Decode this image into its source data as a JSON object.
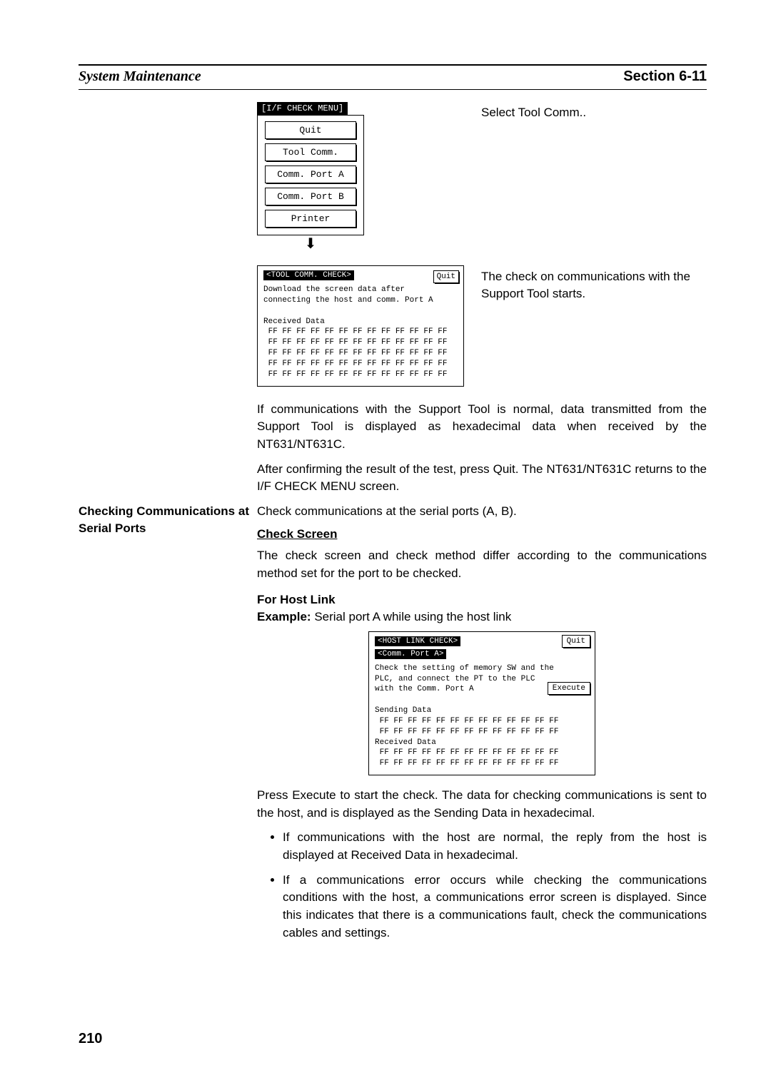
{
  "header": {
    "left": "System Maintenance",
    "right": "Section 6-11"
  },
  "diagram1": {
    "title": "[I/F CHECK MENU]",
    "buttons": [
      "Quit",
      "Tool Comm.",
      "Comm. Port A",
      "Comm. Port B",
      "Printer"
    ],
    "caption": "Select Tool Comm.."
  },
  "diagram2": {
    "title": "<TOOL COMM. CHECK>",
    "quit": "Quit",
    "text": "Download the screen data after\nconnecting the host and comm. Port A\n\nReceived Data\n FF FF FF FF FF FF FF FF FF FF FF FF FF\n FF FF FF FF FF FF FF FF FF FF FF FF FF\n FF FF FF FF FF FF FF FF FF FF FF FF FF\n FF FF FF FF FF FF FF FF FF FF FF FF FF\n FF FF FF FF FF FF FF FF FF FF FF FF FF",
    "caption": "The check on communications with the Support Tool starts."
  },
  "para1": "If communications with the Support Tool is normal, data transmitted from the Support Tool is displayed as hexadecimal data when received by the NT631/NT631C.",
  "para2": "After confirming the result of the test, press Quit. The NT631/NT631C returns to the I/F CHECK MENU screen.",
  "side_heading": "Checking Communications at Serial Ports",
  "para3": "Check communications at the serial ports (A, B).",
  "check_screen_heading": "Check Screen",
  "para4": "The check screen and check method differ according to the communications method set for the port to be checked.",
  "for_host_link": "For Host Link",
  "example_label": "Example:",
  "example_text": " Serial port A while using the host link",
  "host_screen": {
    "title1": "<HOST LINK CHECK>",
    "title2": "<Comm. Port A>",
    "quit": "Quit",
    "execute": "Execute",
    "body": "Check the setting of memory SW and the\nPLC, and connect the PT to the PLC\nwith the Comm. Port A\n\nSending Data\n FF FF FF FF FF FF FF FF FF FF FF FF FF\n FF FF FF FF FF FF FF FF FF FF FF FF FF\nReceived Data\n FF FF FF FF FF FF FF FF FF FF FF FF FF\n FF FF FF FF FF FF FF FF FF FF FF FF FF"
  },
  "para5": "Press Execute to start the check. The data for checking communications is sent to the host, and is displayed as the Sending Data in hexadecimal.",
  "bullets": [
    "If communications with the host are normal, the reply from the host is displayed at Received Data in hexadecimal.",
    "If a communications error occurs while checking the communications conditions with the host, a communications error screen is displayed. Since this indicates that there is a communications fault, check the communications cables and settings."
  ],
  "page_number": "210"
}
